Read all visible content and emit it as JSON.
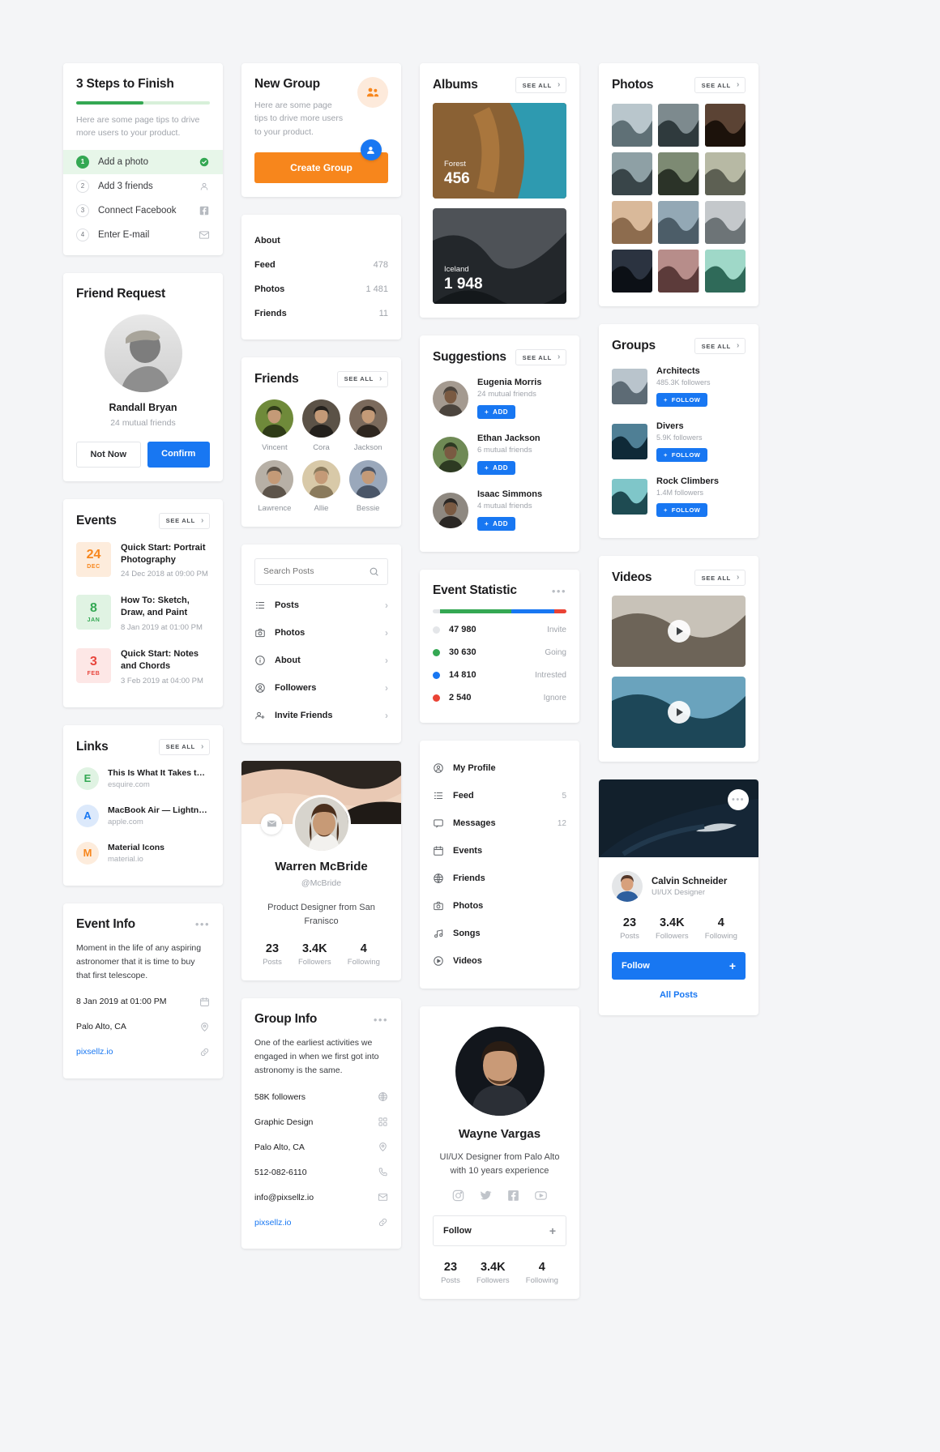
{
  "steps_card": {
    "title": "3 Steps to Finish",
    "progress_percent": 50,
    "description": "Here are some page tips to drive more users to your product.",
    "items": [
      {
        "num": "1",
        "label": "Add a photo",
        "icon": "check-circle-icon",
        "done": true
      },
      {
        "num": "2",
        "label": "Add 3 friends",
        "icon": "person-icon",
        "done": false
      },
      {
        "num": "3",
        "label": "Connect Facebook",
        "icon": "facebook-icon",
        "done": false
      },
      {
        "num": "4",
        "label": "Enter E-mail",
        "icon": "envelope-icon",
        "done": false
      }
    ]
  },
  "friend_request": {
    "title": "Friend Request",
    "name": "Randall Bryan",
    "mutual": "24 mutual friends",
    "decline_label": "Not Now",
    "confirm_label": "Confirm"
  },
  "events": {
    "title": "Events",
    "see_all": "SEE ALL",
    "items": [
      {
        "day": "24",
        "month": "DEC",
        "title": "Quick Start: Portrait Photography",
        "when": "24 Dec 2018 at 09:00 PM",
        "color": "#f7861c",
        "bg": "#fdecdc"
      },
      {
        "day": "8",
        "month": "JAN",
        "title": "How To: Sketch, Draw, and Paint",
        "when": "8 Jan 2019 at 01:00 PM",
        "color": "#34a853",
        "bg": "#e0f3e3"
      },
      {
        "day": "3",
        "month": "FEB",
        "title": "Quick Start: Notes and Chords",
        "when": "3 Feb 2019 at 04:00 PM",
        "color": "#e8453c",
        "bg": "#fde7e6"
      }
    ]
  },
  "links": {
    "title": "Links",
    "see_all": "SEE ALL",
    "items": [
      {
        "letter": "E",
        "title": "This Is What It Takes to…",
        "url": "esquire.com",
        "color": "#34a853",
        "bg": "#e0f3e3"
      },
      {
        "letter": "A",
        "title": "MacBook Air — Lightness…",
        "url": "apple.com",
        "color": "#1877f2",
        "bg": "#dce9fb"
      },
      {
        "letter": "M",
        "title": "Material Icons",
        "url": "material.io",
        "color": "#f7861c",
        "bg": "#fdecdc"
      }
    ]
  },
  "event_info": {
    "title": "Event Info",
    "menu": "•••",
    "description": "Moment in the life of any aspiring astronomer that it is time to buy that first telescope.",
    "rows": [
      {
        "text": "8 Jan 2019 at 01:00 PM",
        "icon": "calendar-icon",
        "link": false
      },
      {
        "text": "Palo Alto, CA",
        "icon": "pin-icon",
        "link": false
      },
      {
        "text": "pixsellz.io",
        "icon": "link-icon",
        "link": true
      }
    ]
  },
  "new_group": {
    "title": "New Group",
    "description": "Here are some page tips to drive more users to your product.",
    "button": "Create Group",
    "badge_icon": "group-icon"
  },
  "about_stats": {
    "rows": [
      {
        "label": "About",
        "value": ""
      },
      {
        "label": "Feed",
        "value": "478"
      },
      {
        "label": "Photos",
        "value": "1 481"
      },
      {
        "label": "Friends",
        "value": "11"
      }
    ]
  },
  "friends": {
    "title": "Friends",
    "see_all": "SEE ALL",
    "people": [
      {
        "name": "Vincent",
        "c1": "#6f8a3a",
        "c2": "#2f3b18"
      },
      {
        "name": "Cora",
        "c1": "#5b5247",
        "c2": "#23201c"
      },
      {
        "name": "Jackson",
        "c1": "#7b6a5c",
        "c2": "#2e261f"
      },
      {
        "name": "Lawrence",
        "c1": "#b7b0a6",
        "c2": "#5d544a"
      },
      {
        "name": "Allie",
        "c1": "#d8c9a8",
        "c2": "#8a7a5c"
      },
      {
        "name": "Bessie",
        "c1": "#9aa8bb",
        "c2": "#4a5668"
      }
    ]
  },
  "search_nav": {
    "placeholder": "Search Posts",
    "search_icon": "search-icon",
    "items": [
      {
        "label": "Posts",
        "icon": "list-icon"
      },
      {
        "label": "Photos",
        "icon": "camera-icon"
      },
      {
        "label": "About",
        "icon": "info-icon"
      },
      {
        "label": "Followers",
        "icon": "person-circle-icon"
      },
      {
        "label": "Invite Friends",
        "icon": "person-add-icon"
      }
    ]
  },
  "profile_warren": {
    "name": "Warren McBride",
    "handle": "@McBride",
    "bio": "Product Designer from San Franisco",
    "message_icon": "envelope-icon",
    "add_friend_icon": "person-add-icon",
    "stats": [
      {
        "n": "23",
        "l": "Posts"
      },
      {
        "n": "3.4K",
        "l": "Followers"
      },
      {
        "n": "4",
        "l": "Following"
      }
    ]
  },
  "group_info": {
    "title": "Group Info",
    "menu": "•••",
    "description": "One of the earliest activities we engaged in when we first got into astronomy is the same.",
    "rows": [
      {
        "text": "58K followers",
        "icon": "globe-icon",
        "link": false
      },
      {
        "text": "Graphic Design",
        "icon": "grid-icon",
        "link": false
      },
      {
        "text": "Palo Alto, CA",
        "icon": "pin-icon",
        "link": false
      },
      {
        "text": "512-082-6110",
        "icon": "phone-icon",
        "link": false
      },
      {
        "text": "info@pixsellz.io",
        "icon": "envelope-icon",
        "link": false
      },
      {
        "text": "pixsellz.io",
        "icon": "link-icon",
        "link": true
      }
    ]
  },
  "albums": {
    "title": "Albums",
    "see_all": "SEE ALL",
    "items": [
      {
        "name": "Forest",
        "count": "456"
      },
      {
        "name": "Iceland",
        "count": "1 948"
      }
    ]
  },
  "suggestions": {
    "title": "Suggestions",
    "see_all": "SEE ALL",
    "add_label": "ADD",
    "items": [
      {
        "name": "Eugenia Morris",
        "mutual": "24 mutual friends",
        "c1": "#a49a90",
        "c2": "#4b443d"
      },
      {
        "name": "Ethan Jackson",
        "mutual": "6 mutual friends",
        "c1": "#6f8a55",
        "c2": "#2d3a22"
      },
      {
        "name": "Isaac Simmons",
        "mutual": "4 mutual friends",
        "c1": "#8e8880",
        "c2": "#2a2724"
      }
    ]
  },
  "event_statistic": {
    "title": "Event Statistic",
    "menu": "•••",
    "chart_data": {
      "type": "bar",
      "title": "Event Statistic",
      "categories": [
        "Invite",
        "Going",
        "Intrested",
        "Ignore"
      ],
      "values": [
        47980,
        30630,
        14810,
        2540
      ],
      "value_labels": [
        "47 980",
        "30 630",
        "14 810",
        "2 540"
      ],
      "colors": [
        "#e4e6e9",
        "#34a853",
        "#1877f2",
        "#ea4335"
      ],
      "segment_percent": [
        0,
        48,
        29,
        8
      ],
      "legend_position": "right",
      "grid": false
    },
    "rows": [
      {
        "value": "47 980",
        "label": "Invite",
        "color": "#e4e6e9"
      },
      {
        "value": "30 630",
        "label": "Going",
        "color": "#34a853"
      },
      {
        "value": "14 810",
        "label": "Intrested",
        "color": "#1877f2"
      },
      {
        "value": "2 540",
        "label": "Ignore",
        "color": "#ea4335"
      }
    ]
  },
  "main_nav": {
    "items": [
      {
        "label": "My Profile",
        "badge": "",
        "icon": "person-circle-icon"
      },
      {
        "label": "Feed",
        "badge": "5",
        "icon": "list-icon"
      },
      {
        "label": "Messages",
        "badge": "12",
        "icon": "chat-icon"
      },
      {
        "label": "Events",
        "badge": "",
        "icon": "calendar-icon"
      },
      {
        "label": "Friends",
        "badge": "",
        "icon": "globe-icon"
      },
      {
        "label": "Photos",
        "badge": "",
        "icon": "camera-icon"
      },
      {
        "label": "Songs",
        "badge": "",
        "icon": "music-icon"
      },
      {
        "label": "Videos",
        "badge": "",
        "icon": "play-icon"
      }
    ]
  },
  "profile_wayne": {
    "name": "Wayne Vargas",
    "bio": "UI/UX Designer from Palo Alto with 10 years experience",
    "socials": [
      "instagram-icon",
      "twitter-icon",
      "facebook-icon",
      "youtube-icon"
    ],
    "follow_label": "Follow",
    "follow_plus": "+",
    "stats": [
      {
        "n": "23",
        "l": "Posts"
      },
      {
        "n": "3.4K",
        "l": "Followers"
      },
      {
        "n": "4",
        "l": "Following"
      }
    ]
  },
  "photos": {
    "title": "Photos",
    "see_all": "SEE ALL",
    "tiles": [
      {
        "c1": "#b9c6cc",
        "c2": "#5f7076"
      },
      {
        "c1": "#7d8a8e",
        "c2": "#2f3a3d"
      },
      {
        "c1": "#5b4334",
        "c2": "#1c120b"
      },
      {
        "c1": "#8ea0a5",
        "c2": "#394549"
      },
      {
        "c1": "#7d8a73",
        "c2": "#2b3328"
      },
      {
        "c1": "#b7b9a4",
        "c2": "#5d6053"
      },
      {
        "c1": "#d9b99a",
        "c2": "#8d6c4e"
      },
      {
        "c1": "#93a8b5",
        "c2": "#4c5d68"
      },
      {
        "c1": "#c4c8cb",
        "c2": "#6d7477"
      },
      {
        "c1": "#2b3340",
        "c2": "#0c1016"
      },
      {
        "c1": "#b78d8a",
        "c2": "#5c3b3a"
      },
      {
        "c1": "#9fd8c8",
        "c2": "#2f6a59"
      }
    ]
  },
  "groups": {
    "title": "Groups",
    "see_all": "SEE ALL",
    "follow_label": "FOLLOW",
    "items": [
      {
        "name": "Architects",
        "followers": "485.3K followers",
        "c1": "#b9c4cc",
        "c2": "#5d6b75"
      },
      {
        "name": "Divers",
        "followers": "5.9K followers",
        "c1": "#4f7f95",
        "c2": "#0f2a38"
      },
      {
        "name": "Rock Climbers",
        "followers": "1.4M followers",
        "c1": "#7fc6c9",
        "c2": "#1e4b52"
      }
    ]
  },
  "videos": {
    "title": "Videos",
    "see_all": "SEE ALL",
    "items": [
      {
        "c1": "#c8c2b8",
        "c2": "#6d6458"
      },
      {
        "c1": "#6aa3bd",
        "c2": "#1d4758"
      }
    ]
  },
  "person_calvin": {
    "name": "Calvin Schneider",
    "role": "UI/UX Designer",
    "menu": "•••",
    "follow_label": "Follow",
    "follow_plus": "+",
    "all_posts": "All Posts",
    "stats": [
      {
        "n": "23",
        "l": "Posts"
      },
      {
        "n": "3.4K",
        "l": "Followers"
      },
      {
        "n": "4",
        "l": "Following"
      }
    ]
  },
  "colors": {
    "accent_blue": "#1877f2",
    "accent_orange": "#f7861c",
    "green": "#34a853",
    "red": "#ea4335",
    "page_bg": "#f4f5f7"
  }
}
